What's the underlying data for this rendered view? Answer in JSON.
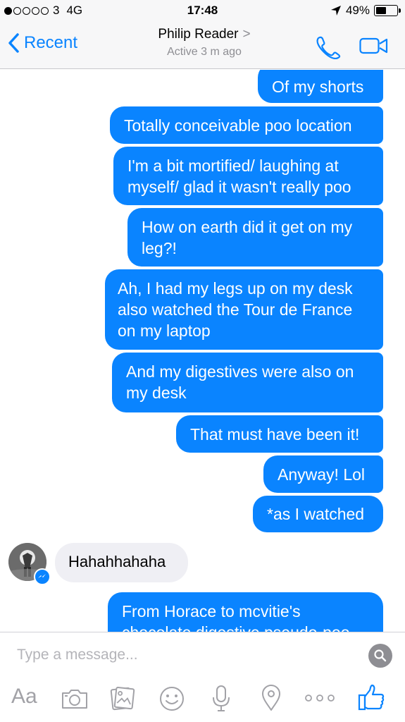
{
  "status": {
    "carrier": "3",
    "network": "4G",
    "time": "17:48",
    "battery": "49%",
    "battery_level": 0.49
  },
  "header": {
    "back_label": "Recent",
    "contact_name": "Philip Reader",
    "chevron": ">",
    "presence": "Active 3 m ago"
  },
  "messages": {
    "m1": "Of my shorts",
    "m2": "Totally conceivable poo location",
    "m3a": "I'm a bit mortified/ laughing at",
    "m3b": "myself/ glad it wasn't really poo",
    "m4a": "How on earth did it get on my",
    "m4b": "leg?!",
    "m5a": "Ah, I had my legs up on my desk",
    "m5b": "also watched the Tour de France",
    "m5c": "on my laptop",
    "m6a": "And my digestives were also on",
    "m6b": "my desk",
    "m7": "That must have been it!",
    "m8": "Anyway! Lol",
    "m9": "*as I watched",
    "in1": "Hahahhahaha",
    "m10a": "From Horace to mcvitie's",
    "m10b": "chocolate digestive pseudo-poo"
  },
  "composer": {
    "placeholder": "Type a message...",
    "aa_label": "Aa"
  },
  "colors": {
    "accent": "#0a84ff",
    "incoming": "#efeff4"
  }
}
